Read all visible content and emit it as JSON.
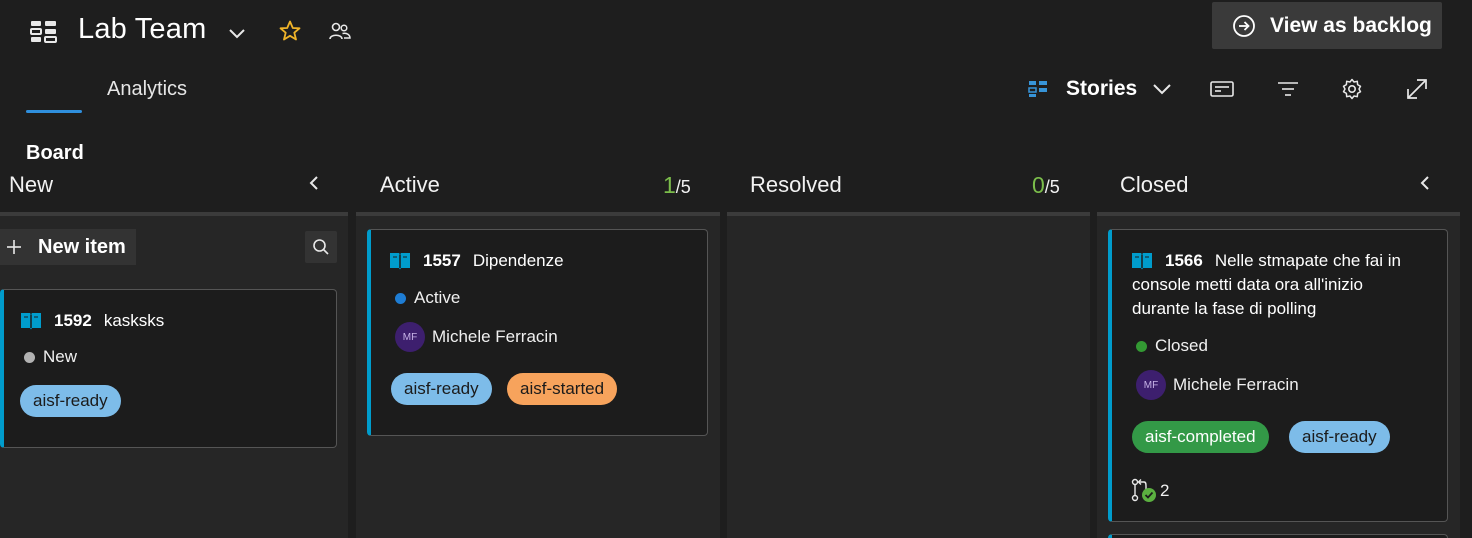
{
  "header": {
    "team_name": "Lab Team",
    "view_backlog_label": "View as backlog",
    "tabs": [
      {
        "label": "Board",
        "active": true
      },
      {
        "label": "Analytics",
        "active": false
      }
    ],
    "level_selector": "Stories"
  },
  "colors": {
    "accent": "#2f8fdd",
    "card_bar": "#009ccc",
    "wip_ok": "#7bbd4b"
  },
  "columns": [
    {
      "title": "New",
      "new_item_label": "New item",
      "cards": [
        {
          "id": "1592",
          "title": "kasksks",
          "state": "New",
          "state_color": "#b2b2b2",
          "tags": [
            {
              "label": "aisf-ready",
              "color": "#7dbce9"
            }
          ]
        }
      ]
    },
    {
      "title": "Active",
      "wip_current": "1",
      "wip_limit": "/5",
      "cards": [
        {
          "id": "1557",
          "title": "Dipendenze",
          "state": "Active",
          "state_color": "#1e7dd4",
          "assignee_initials": "MF",
          "assignee": "Michele Ferracin",
          "tags": [
            {
              "label": "aisf-ready",
              "color": "#7dbce9"
            },
            {
              "label": "aisf-started",
              "color": "#f7a35c"
            }
          ]
        }
      ]
    },
    {
      "title": "Resolved",
      "wip_current": "0",
      "wip_limit": "/5",
      "cards": []
    },
    {
      "title": "Closed",
      "cards": [
        {
          "id": "1566",
          "title_lines": [
            "Nelle stmapate che fai in",
            "console metti data ora all'inizio",
            "durante la fase di polling"
          ],
          "state": "Closed",
          "state_color": "#339933",
          "assignee_initials": "MF",
          "assignee": "Michele Ferracin",
          "tags": [
            {
              "label": "aisf-completed",
              "color": "#339947"
            },
            {
              "label": "aisf-ready",
              "color": "#7dbce9"
            }
          ],
          "pull_requests": "2"
        }
      ]
    }
  ]
}
